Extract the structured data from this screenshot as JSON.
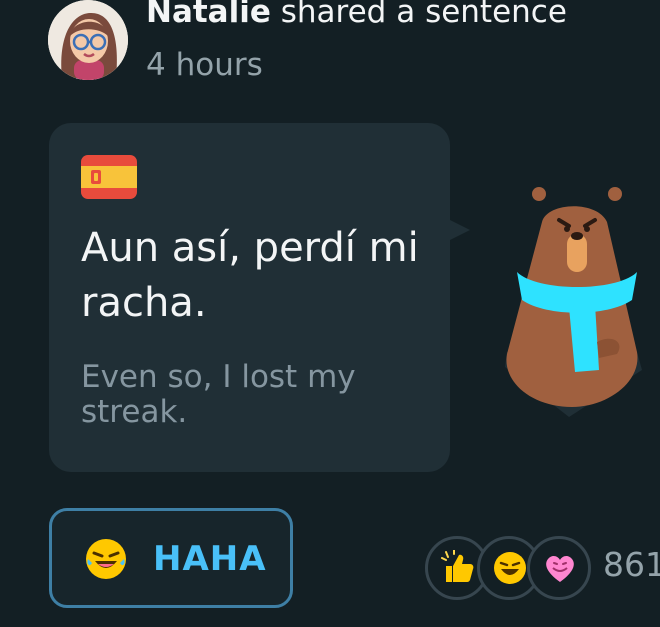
{
  "post": {
    "author": "Natalie",
    "action": "shared a sentence",
    "time": "4 hours"
  },
  "card": {
    "flag_icon": "spain-flag-icon",
    "sentence": "Aun así, perdí mi racha.",
    "translation": "Even so, I lost my streak."
  },
  "reaction_button": {
    "icon": "laughing-emoji-icon",
    "label": "HAHA"
  },
  "reactions": {
    "icons": [
      "thumbs-up-icon",
      "laughing-emoji-icon",
      "heart-icon"
    ],
    "count": "861"
  },
  "colors": {
    "background": "#131f24",
    "bubble": "#202f36",
    "accent": "#49c0f8",
    "muted_text": "#94a3aa"
  }
}
